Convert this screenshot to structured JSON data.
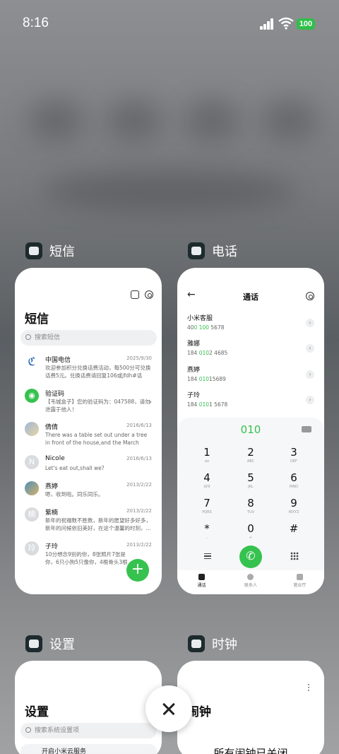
{
  "status_bar": {
    "time": "8:16",
    "battery": "100"
  },
  "apps": {
    "sms": {
      "name": "短信"
    },
    "phone": {
      "name": "电话"
    },
    "settings": {
      "name": "设置"
    },
    "clock": {
      "name": "时钟"
    }
  },
  "sms": {
    "title": "短信",
    "search_placeholder": "搜索短信",
    "messages": [
      {
        "name": "中国电信",
        "date": "2025/9/30",
        "body": "欢迎参加积分兑换话费活动，每500分可兑换话费5元。兑换话费请回复106或jfdh#话费..."
      },
      {
        "name": "验证码",
        "date": "",
        "body": "【韦城盒子】您的验证码为：047588，请勿泄露于他人！"
      },
      {
        "name": "倩倩",
        "date": "2016/6/13",
        "body": "There was a table set out under a tree in front of the house,and the March Hare an..."
      },
      {
        "name": "Nicole",
        "date": "2016/6/13",
        "body": "Let's eat out,shall we?"
      },
      {
        "name": "燕婷",
        "date": "2013/2/22",
        "body": "嗯，收到啦。同乐同乐。"
      },
      {
        "name": "紫楠",
        "date": "2013/2/22",
        "body": "新年的祝福数不胜数，新年的愿望好多好多，新年的问候依旧美好，在这个温馨的时刻，..."
      },
      {
        "name": "子玲",
        "date": "2013/2/22",
        "body": "10分想念9别的你，8张照片7张是你，6只小狗5只像你，4根骨头3根归你，2爪真的没办..."
      }
    ],
    "avatars": {
      "nicole": "N",
      "zinan": "楠",
      "ziling": "玲"
    },
    "fab": "+"
  },
  "phone": {
    "title": "通话",
    "contacts": [
      {
        "name": "小米客服",
        "num_pre": "40",
        "num_hl": "0 100",
        "num_post": " 5678"
      },
      {
        "name": "雅娜",
        "num_pre": "184 ",
        "num_hl": "010",
        "num_post": "2 4685"
      },
      {
        "name": "燕婷",
        "num_pre": "184 ",
        "num_hl": "010",
        "num_post": "15689"
      },
      {
        "name": "子玲",
        "num_pre": "184 ",
        "num_hl": "010",
        "num_post": "1 5678"
      }
    ],
    "dial_number": "010",
    "keys": [
      {
        "d": "1",
        "l": "oo"
      },
      {
        "d": "2",
        "l": "ABC"
      },
      {
        "d": "3",
        "l": "DEF"
      },
      {
        "d": "4",
        "l": "GHI"
      },
      {
        "d": "5",
        "l": "JKL"
      },
      {
        "d": "6",
        "l": "MNO"
      },
      {
        "d": "7",
        "l": "PQRS"
      },
      {
        "d": "8",
        "l": "TUV"
      },
      {
        "d": "9",
        "l": "WXYZ"
      },
      {
        "d": "*",
        "l": ","
      },
      {
        "d": "0",
        "l": "+"
      },
      {
        "d": "#",
        "l": ""
      }
    ],
    "tabs": {
      "calls": "通话",
      "contacts": "联系人",
      "store": "营业厅"
    }
  },
  "settings": {
    "title": "设置",
    "search_placeholder": "搜索系统设置项",
    "first_row": "开启小米云服务"
  },
  "clock": {
    "title": "闹钟",
    "message": "所有闹钟已关闭"
  },
  "colors": {
    "accent_green": "#35c24e",
    "battery_green": "#2fbf4a"
  }
}
